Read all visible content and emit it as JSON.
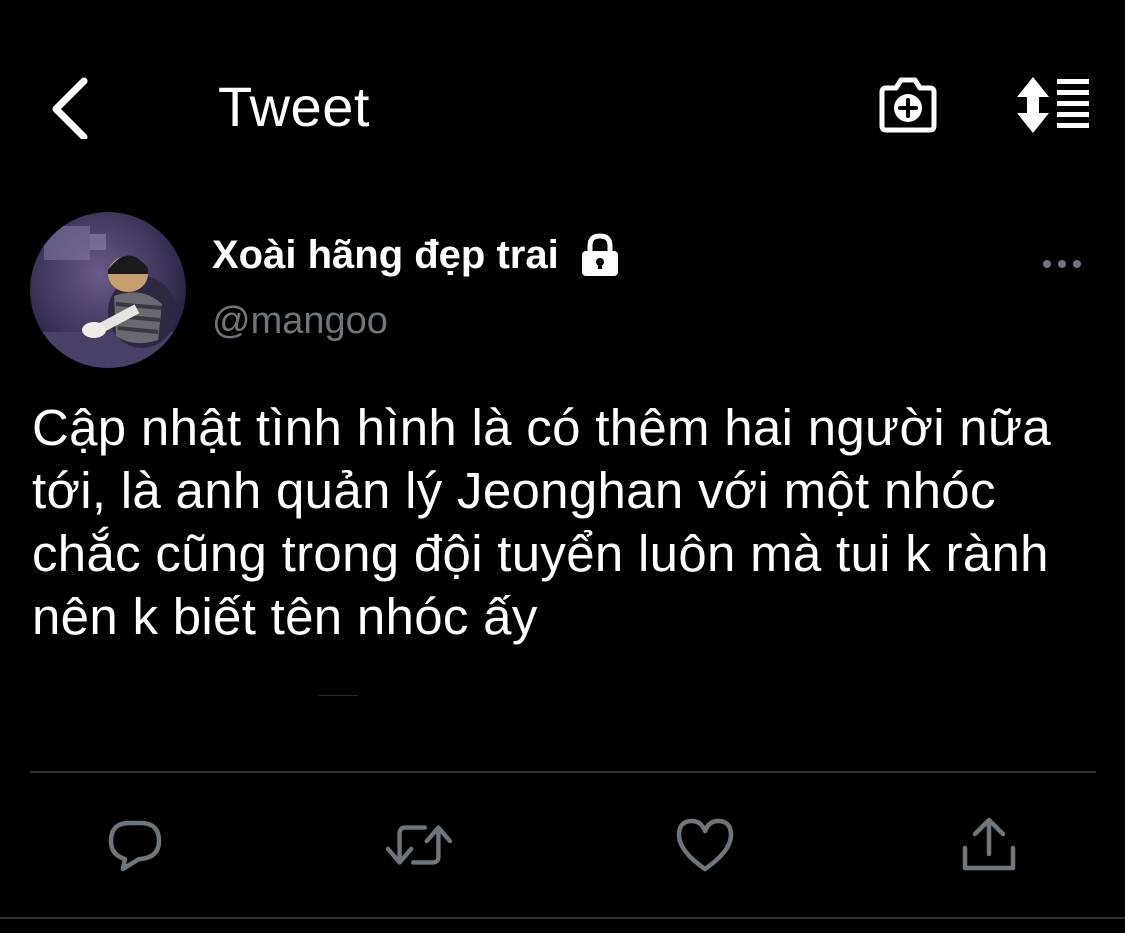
{
  "header": {
    "title": "Tweet",
    "back_icon": "chevron-left-icon",
    "camera_icon": "camera-plus-icon",
    "sort_icon": "sort-list-icon"
  },
  "tweet": {
    "display_name": "Xoài hãng đẹp trai",
    "handle": "@mangoo",
    "protected": true,
    "text": "Cập nhật tình hình là có thêm hai người nữa tới, là anh quản lý Jeonghan với một nhóc chắc cũng trong đội tuyển luôn mà tui k rành nên k biết tên nhóc ấy"
  },
  "actions": {
    "reply_icon": "reply-icon",
    "retweet_icon": "retweet-icon",
    "like_icon": "heart-icon",
    "share_icon": "share-icon"
  },
  "colors": {
    "background": "#000000",
    "text": "#ffffff",
    "secondary_text": "#6e767d",
    "divider": "#2f3336"
  }
}
